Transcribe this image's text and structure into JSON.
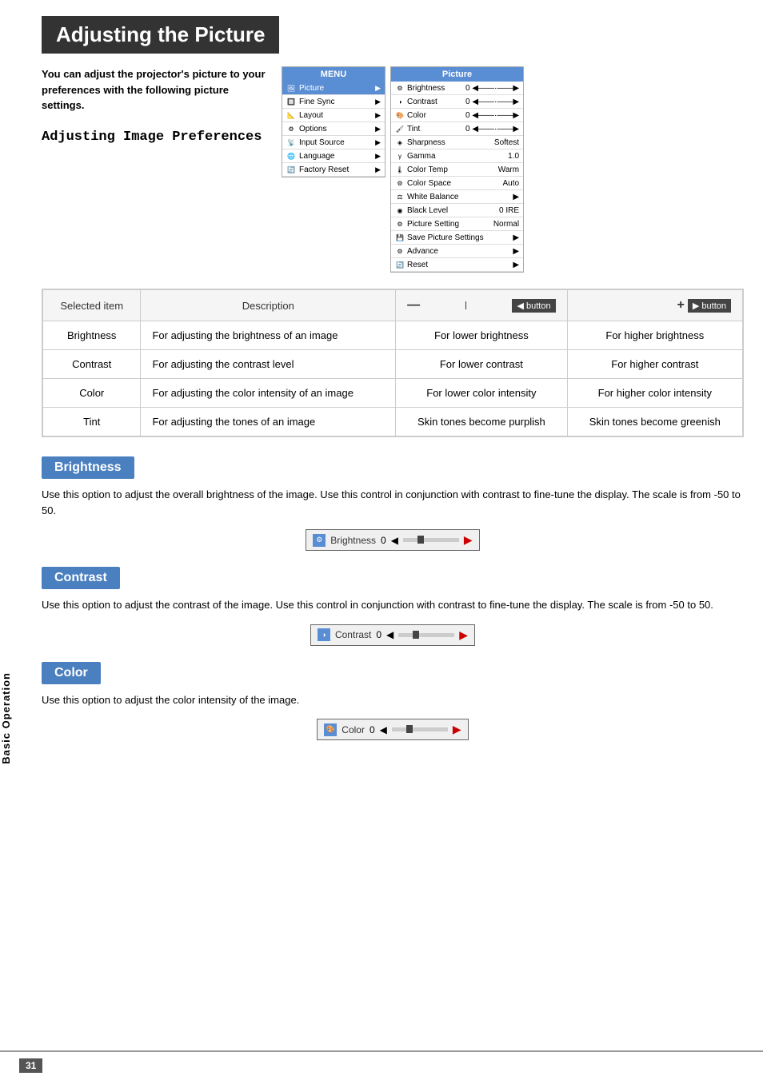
{
  "page": {
    "title": "Adjusting the Picture",
    "page_number": "31",
    "sidebar_label": "Basic Operation"
  },
  "intro": {
    "text": "You can adjust the projector's picture to your preferences with the following picture settings.",
    "subheading": "Adjusting Image Preferences"
  },
  "menu": {
    "header": "MENU",
    "items": [
      {
        "label": "Picture",
        "selected": true
      },
      {
        "label": "Fine Sync"
      },
      {
        "label": "Layout"
      },
      {
        "label": "Options"
      },
      {
        "label": "Input Source"
      },
      {
        "label": "Language"
      },
      {
        "label": "Factory Reset"
      }
    ]
  },
  "picture_menu": {
    "header": "Picture",
    "rows": [
      {
        "label": "Brightness",
        "value": "0",
        "has_slider": true
      },
      {
        "label": "Contrast",
        "value": "0",
        "has_slider": true
      },
      {
        "label": "Color",
        "value": "0",
        "has_slider": true
      },
      {
        "label": "Tint",
        "value": "0",
        "has_slider": true
      },
      {
        "label": "Sharpness",
        "value": "Softest"
      },
      {
        "label": "Gamma",
        "value": "1.0"
      },
      {
        "label": "Color Temp",
        "value": "Warm"
      },
      {
        "label": "Color Space",
        "value": "Auto"
      },
      {
        "label": "White Balance",
        "has_arrow": true
      },
      {
        "label": "Black Level",
        "value": "0 IRE"
      },
      {
        "label": "Picture Setting",
        "value": "Normal"
      },
      {
        "label": "Save Picture Settings",
        "has_arrow": true
      },
      {
        "label": "Advance",
        "has_arrow": true
      },
      {
        "label": "Reset",
        "has_arrow": true
      }
    ]
  },
  "table": {
    "headers": [
      "Selected item",
      "Description",
      "- button",
      "+ button"
    ],
    "rows": [
      {
        "item": "Brightness",
        "description": "For adjusting the brightness of an image",
        "minus": "For lower brightness",
        "plus": "For higher brightness"
      },
      {
        "item": "Contrast",
        "description": "For adjusting the contrast level",
        "minus": "For lower contrast",
        "plus": "For higher contrast"
      },
      {
        "item": "Color",
        "description": "For adjusting the color intensity of an image",
        "minus": "For lower color intensity",
        "plus": "For higher color intensity"
      },
      {
        "item": "Tint",
        "description": "For adjusting the tones of an image",
        "minus": "Skin tones become purplish",
        "plus": "Skin tones become greenish"
      }
    ]
  },
  "sections": [
    {
      "id": "brightness",
      "title": "Brightness",
      "body": "Use this option to adjust the overall brightness of the image. Use this control in conjunction with contrast to fine-tune the display. The scale is from -50 to 50.",
      "control_label": "Brightness",
      "control_value": "0"
    },
    {
      "id": "contrast",
      "title": "Contrast",
      "body": "Use this option to adjust the contrast of the image. Use this control in conjunction with contrast to fine-tune the display. The scale is from -50 to 50.",
      "control_label": "Contrast",
      "control_value": "0"
    },
    {
      "id": "color",
      "title": "Color",
      "body": "Use this option to adjust the color intensity of the image.",
      "control_label": "Color",
      "control_value": "0"
    }
  ]
}
